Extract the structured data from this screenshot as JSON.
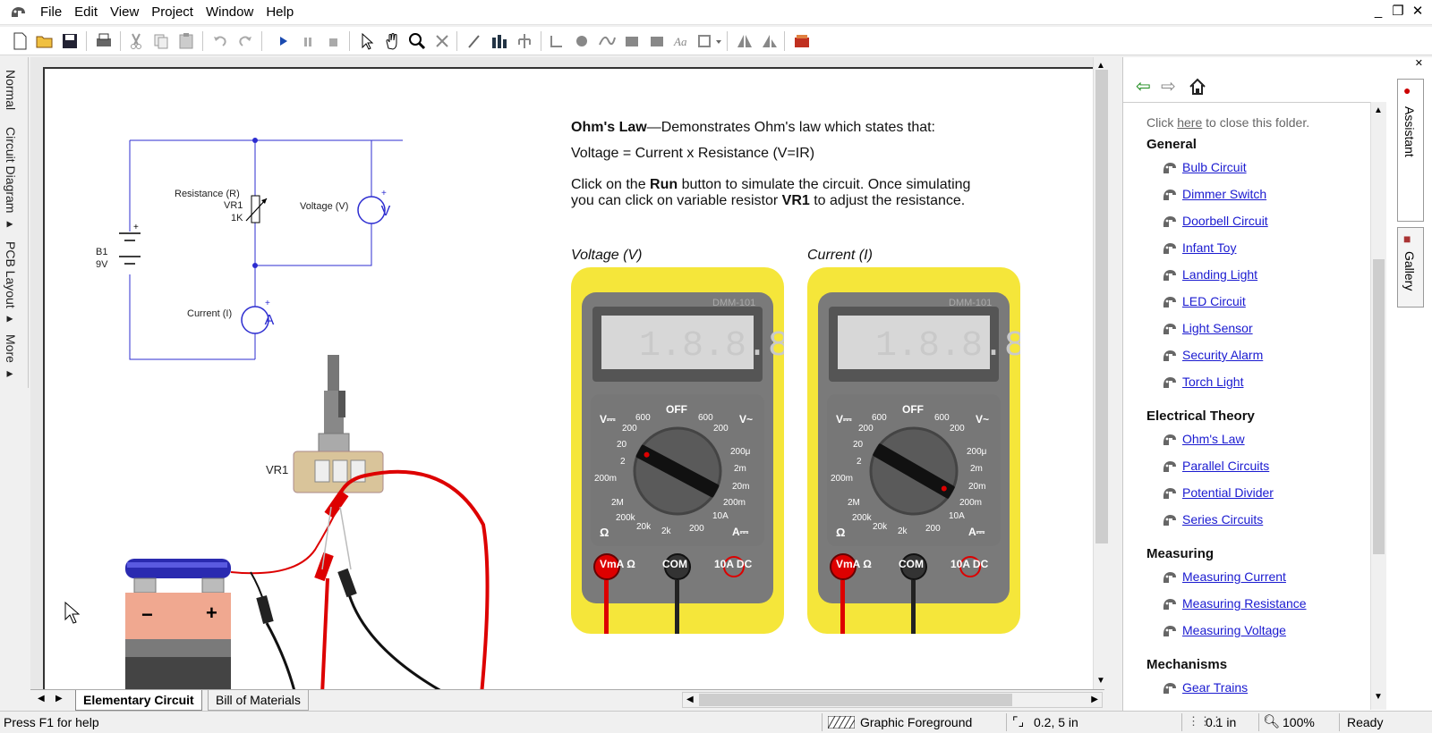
{
  "menubar": {
    "items": [
      "File",
      "Edit",
      "View",
      "Project",
      "Window",
      "Help"
    ]
  },
  "left_tabs": [
    "Normal",
    "Circuit Diagram ▸",
    "PCB Layout ▸",
    "More ▸"
  ],
  "description": {
    "title": "Ohm's Law",
    "title_rest": "—Demonstrates Ohm's law which states that:",
    "formula": "Voltage = Current x Resistance (V=IR)",
    "line1_a": "Click on the ",
    "run": "Run",
    "line1_b": " button to simulate the circuit. Once simulating",
    "line2_a": "you can click on variable resistor ",
    "vr1": "VR1",
    "line2_b": " to adjust the resistance."
  },
  "schematic": {
    "resistance": "Resistance (R)",
    "vr1": "VR1",
    "vr1_value": "1K",
    "voltage": "Voltage (V)",
    "b1": "B1",
    "b1_value": "9V",
    "current": "Current (I)",
    "v_symbol": "V",
    "a_symbol": "A"
  },
  "breadboard": {
    "vr1": "VR1",
    "minus": "−",
    "plus": "+"
  },
  "meters": [
    {
      "caption": "Voltage (V)",
      "model": "DMM-101",
      "pointer_angle": 28
    },
    {
      "caption": "Current (I)",
      "model": "DMM-101",
      "pointer_angle": 30
    }
  ],
  "meter_labels": {
    "off": "OFF",
    "vdc": "V⎓",
    "vac": "V~",
    "ohm": "Ω",
    "adc": "A⎓",
    "left_v": [
      "600",
      "200",
      "20",
      "2",
      "200m"
    ],
    "right_v": [
      "600",
      "200"
    ],
    "right_a": [
      "200μ",
      "2m",
      "20m",
      "200m",
      "10A"
    ],
    "ohms": [
      "2M",
      "200k",
      "20k",
      "2k",
      "200"
    ],
    "jack_v": "VmA Ω",
    "jack_com": "COM",
    "jack_10a": "10A DC"
  },
  "doc_tabs": [
    {
      "label": "Elementary Circuit",
      "active": true
    },
    {
      "label": "Bill of Materials",
      "active": false
    }
  ],
  "status": {
    "help": "Press F1 for help",
    "layer": "Graphic Foreground",
    "coords": "0.2, 5 in",
    "grid": "0.1 in",
    "zoom": "100%",
    "state": "Ready"
  },
  "panel": {
    "close_text_a": "Click ",
    "close_link": "here",
    "close_text_b": " to close this folder.",
    "side_tabs": [
      "Assistant",
      "Gallery"
    ],
    "groups": [
      {
        "name": "General",
        "items": [
          "Bulb Circuit",
          "Dimmer Switch",
          "Doorbell Circuit",
          "Infant Toy",
          "Landing Light",
          "LED Circuit",
          "Light Sensor",
          "Security Alarm",
          "Torch Light"
        ]
      },
      {
        "name": "Electrical Theory",
        "items": [
          "Ohm's Law",
          "Parallel Circuits",
          "Potential Divider",
          "Series Circuits"
        ]
      },
      {
        "name": "Measuring",
        "items": [
          "Measuring Current",
          "Measuring Resistance",
          "Measuring Voltage"
        ]
      },
      {
        "name": "Mechanisms",
        "items": [
          "Gear Trains"
        ]
      }
    ]
  },
  "colors": {
    "link": "#1a1ad0",
    "meter_yellow": "#f5e63a",
    "meter_body": "#7a7a7a",
    "battery_top": "#2a2ab0",
    "battery_body": "#f0a890"
  }
}
